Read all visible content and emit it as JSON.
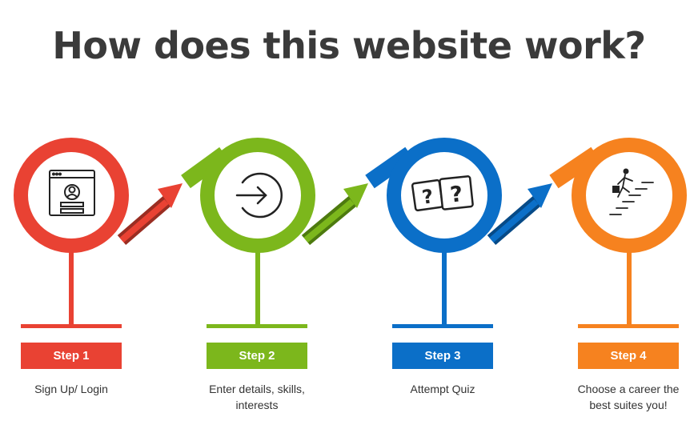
{
  "title": "How does this website work?",
  "colors": {
    "step1": "#e94233",
    "step2": "#7cb71c",
    "step3": "#0b6fc8",
    "step4": "#f6821f",
    "title": "#3a3a3a"
  },
  "steps": [
    {
      "label": "Step 1",
      "description": "Sign Up/ Login",
      "icon": "login-profile-icon"
    },
    {
      "label": "Step 2",
      "description": "Enter details, skills, interests",
      "icon": "arrow-enter-icon"
    },
    {
      "label": "Step 3",
      "description": "Attempt Quiz",
      "icon": "question-cards-icon"
    },
    {
      "label": "Step 4",
      "description": "Choose a career the best suites you!",
      "icon": "career-stairs-icon"
    }
  ]
}
